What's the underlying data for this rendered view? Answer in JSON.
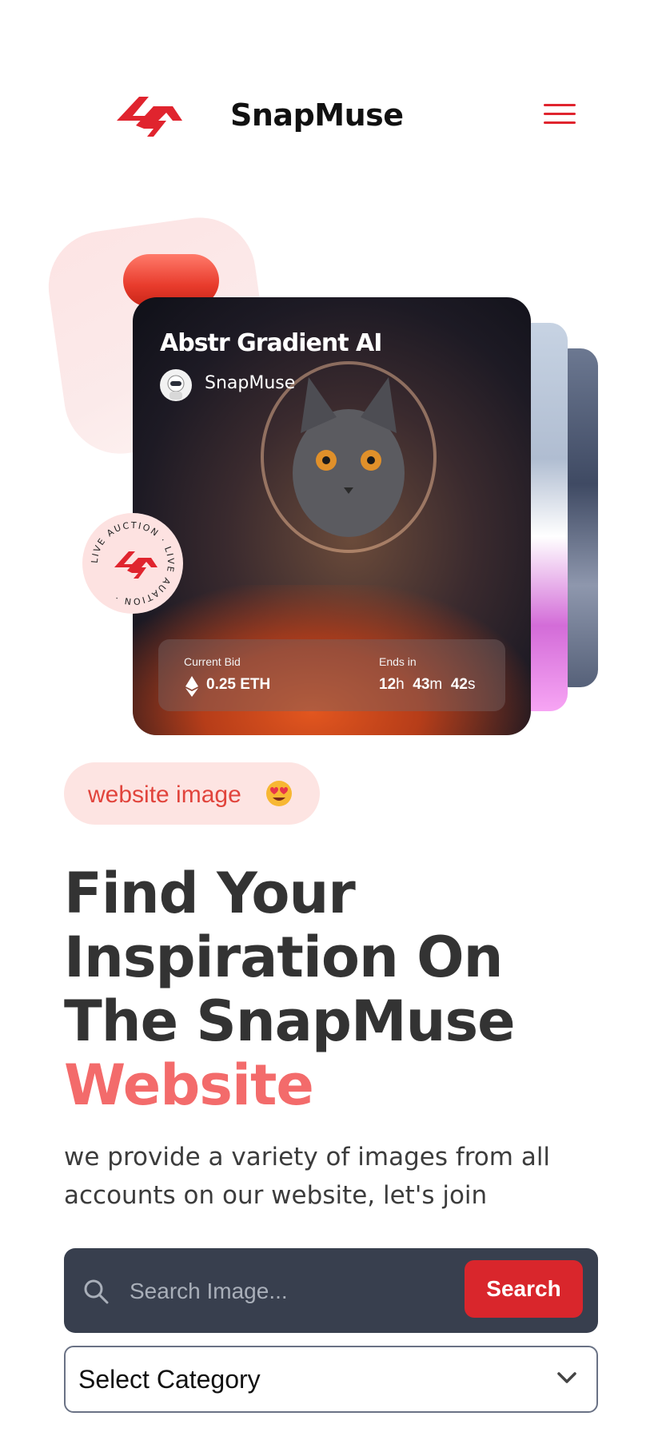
{
  "header": {
    "brand": "SnapMuse",
    "logo_icon": "snapmuse-logo-icon",
    "menu_icon": "hamburger-menu-icon",
    "accent_color": "#e0242e"
  },
  "hero_card": {
    "title": "Abstr Gradient AI",
    "creator": "SnapMuse",
    "current_bid_label": "Current Bid",
    "current_bid_value": "0.25 ETH",
    "ends_label": "Ends in",
    "timer": {
      "hours": "12",
      "hours_unit": "h",
      "minutes": "43",
      "minutes_unit": "m",
      "seconds": "42",
      "seconds_unit": "s"
    },
    "badge_text": "LIVE AUCTION · LIVE AUATION ·"
  },
  "tag": {
    "label": "website image",
    "emoji_icon": "heart-eyes-emoji-icon"
  },
  "headline": {
    "line1": "Find Your",
    "line2": "Inspiration On",
    "line3": "The SnapMuse",
    "accent": "Website",
    "accent_color": "#f36b6b"
  },
  "subtext": "we provide a variety of images from all accounts on our website, let's join",
  "search": {
    "placeholder": "Search Image...",
    "button_label": "Search",
    "button_color": "#d9262c"
  },
  "category_select": {
    "selected": "Select Category"
  }
}
